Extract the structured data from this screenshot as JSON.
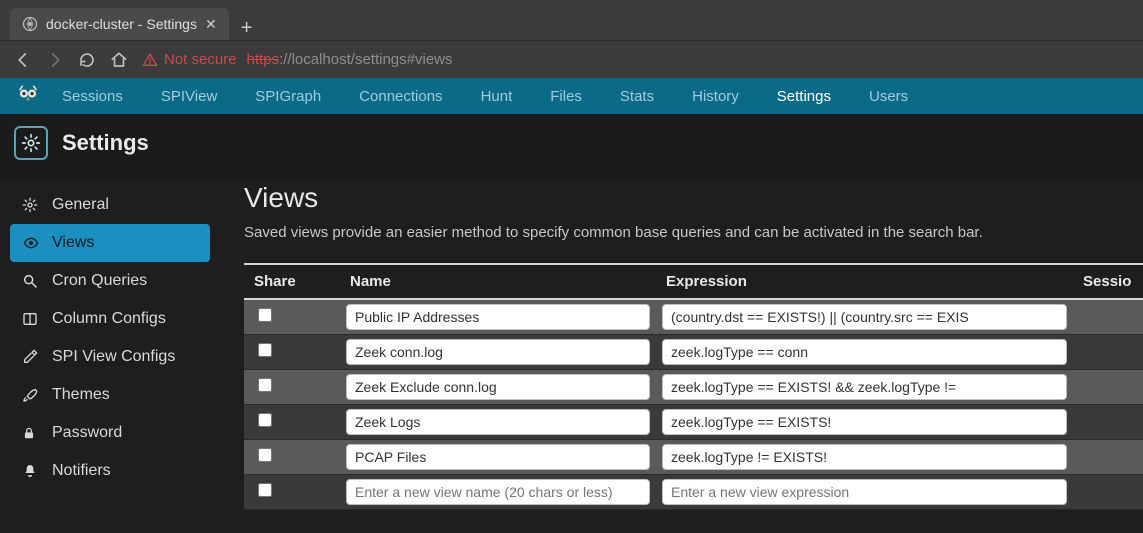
{
  "browser": {
    "tab_title": "docker-cluster - Settings",
    "not_secure_label": "Not secure",
    "url_https": "https",
    "url_rest": "://localhost/settings#views"
  },
  "topnav": {
    "items": [
      "Sessions",
      "SPIView",
      "SPIGraph",
      "Connections",
      "Hunt",
      "Files",
      "Stats",
      "History",
      "Settings",
      "Users"
    ],
    "active": "Settings"
  },
  "page": {
    "title": "Settings"
  },
  "sidebar": {
    "items": [
      {
        "icon": "gear",
        "label": "General"
      },
      {
        "icon": "eye",
        "label": "Views"
      },
      {
        "icon": "search",
        "label": "Cron Queries"
      },
      {
        "icon": "columns",
        "label": "Column Configs"
      },
      {
        "icon": "dropper",
        "label": "SPI View Configs"
      },
      {
        "icon": "brush",
        "label": "Themes"
      },
      {
        "icon": "lock",
        "label": "Password"
      },
      {
        "icon": "bell",
        "label": "Notifiers"
      }
    ],
    "active_index": 1
  },
  "views": {
    "heading": "Views",
    "description": "Saved views provide an easier method to specify common base queries and can be activated in the search bar.",
    "columns": {
      "share": "Share",
      "name": "Name",
      "expression": "Expression",
      "session": "Sessio"
    },
    "rows": [
      {
        "share": false,
        "name": "Public IP Addresses",
        "expression": "(country.dst == EXISTS!) || (country.src == EXIS"
      },
      {
        "share": false,
        "name": "Zeek conn.log",
        "expression": "zeek.logType == conn"
      },
      {
        "share": false,
        "name": "Zeek Exclude conn.log",
        "expression": "zeek.logType == EXISTS! && zeek.logType !="
      },
      {
        "share": false,
        "name": "Zeek Logs",
        "expression": "zeek.logType == EXISTS!"
      },
      {
        "share": false,
        "name": "PCAP Files",
        "expression": "zeek.logType != EXISTS!"
      }
    ],
    "new_row": {
      "name_placeholder": "Enter a new view name (20 chars or less)",
      "expr_placeholder": "Enter a new view expression"
    }
  }
}
